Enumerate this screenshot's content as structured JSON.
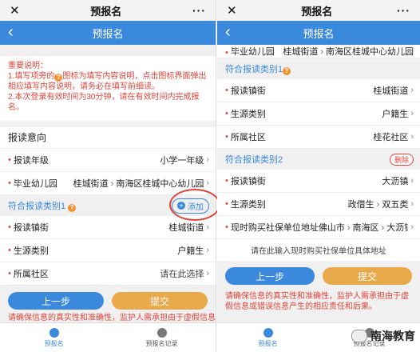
{
  "left": {
    "window_title": "预报名",
    "nav_title": "预报名",
    "notice": {
      "heading": "重要说明：",
      "line1_pre": "1.填写项旁的",
      "line1_post": "图标为填写内容说明，点击图标界面弹出相应填写内容说明，请务必在填写前细读。",
      "line2": "2.本次登录有效时间为30分钟，请在有效时间内完成报名。"
    },
    "section_title": "报读意向",
    "grade": {
      "label": "报读年级",
      "value": "小学一年级"
    },
    "kindergarten": {
      "label": "毕业幼儿园",
      "street": "桂城街道",
      "school": "南海区桂城中心幼儿园"
    },
    "category": {
      "label": "符合报读类别1",
      "add": "添加"
    },
    "town": {
      "label": "报读镇街",
      "value": "桂城街道"
    },
    "origin": {
      "label": "生源类别",
      "value": "户籍生"
    },
    "community": {
      "label": "所属社区",
      "value": "请在此选择"
    },
    "buttons": {
      "prev": "上一步",
      "submit": "提交"
    },
    "disclaimer": "请确保信息的真实性和准确性，监护人需承担由于虚假信息",
    "tabs": [
      "预报名",
      "预报名记录"
    ]
  },
  "right": {
    "window_title": "预报名",
    "nav_title": "预报名",
    "top_row": {
      "label": "毕业幼儿园",
      "street": "桂城街道",
      "school": "南海区桂城中心幼儿园"
    },
    "cat1": {
      "label": "符合报读类别1"
    },
    "cat1_town": {
      "label": "报读镇街",
      "value": "桂城街道"
    },
    "cat1_origin": {
      "label": "生源类别",
      "value": "户籍生"
    },
    "cat1_community": {
      "label": "所属社区",
      "value": "桂花社区"
    },
    "cat2": {
      "label": "符合报读类别2",
      "delete": "删除"
    },
    "cat2_town": {
      "label": "报读镇街",
      "value": "大沥镇"
    },
    "cat2_origin": {
      "label": "生源类别",
      "value1": "政借生",
      "value2": "双五类"
    },
    "cat2_address": {
      "label": "现时购买社保单位地址",
      "city": "佛山市",
      "district": "南海区",
      "town": "大沥镇"
    },
    "hint": "请在此输入现时购买社保单位具体地址",
    "buttons": {
      "prev": "上一步",
      "submit": "提交"
    },
    "disclaimer": "请确保信息的真实性和准确性，监护人需承担由于虚假信息或错误信息产生的相应责任和后果。",
    "tabs": [
      "预报名",
      "预报名记录"
    ]
  },
  "watermark": "南海教育",
  "colors": {
    "brand": "#3a89dd",
    "alert": "#e0443a",
    "submit": "#e8a94a"
  }
}
